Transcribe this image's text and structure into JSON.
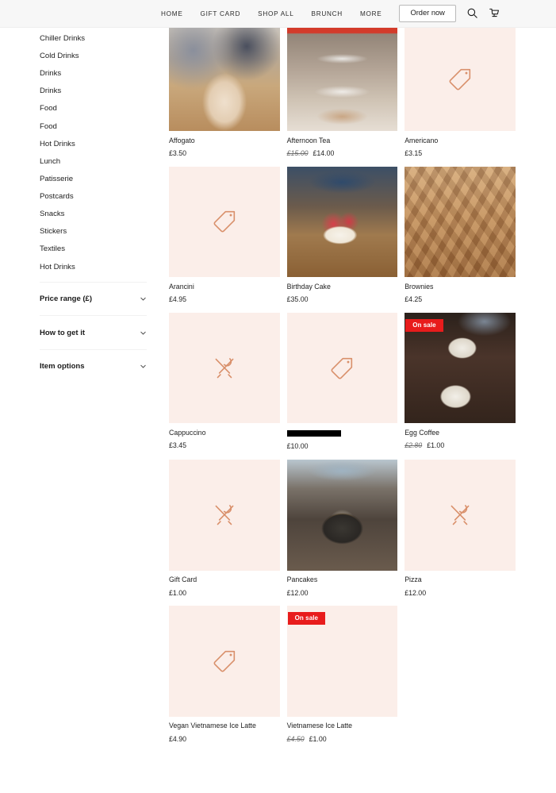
{
  "header": {
    "nav": [
      {
        "label": "HOME",
        "name": "nav-home"
      },
      {
        "label": "GIFT CARD",
        "name": "nav-gift-card"
      },
      {
        "label": "SHOP ALL",
        "name": "nav-shop-all"
      },
      {
        "label": "BRUNCH",
        "name": "nav-brunch"
      },
      {
        "label": "MORE",
        "name": "nav-more"
      }
    ],
    "order_now_label": "Order now",
    "search_icon": "search-icon",
    "cart_icon": "shopping-cart-icon",
    "background": "#f7f7f7"
  },
  "sidebar": {
    "categories": [
      {
        "label": "Chiller Drinks"
      },
      {
        "label": "Cold Drinks"
      },
      {
        "label": "Drinks"
      },
      {
        "label": "Drinks"
      },
      {
        "label": "Food"
      },
      {
        "label": "Food"
      },
      {
        "label": "Hot Drinks"
      },
      {
        "label": "Lunch"
      },
      {
        "label": "Patisserie"
      },
      {
        "label": "Postcards"
      },
      {
        "label": "Snacks"
      },
      {
        "label": "Stickers"
      },
      {
        "label": "Textiles"
      },
      {
        "label": "Hot Drinks"
      }
    ],
    "filters": [
      {
        "label": "Price range (£)",
        "icon": "chevron-down-icon",
        "expanded": false
      },
      {
        "label": "How to get it",
        "icon": "chevron-down-icon",
        "expanded": false
      },
      {
        "label": "Item options",
        "icon": "chevron-down-icon",
        "expanded": false
      }
    ]
  },
  "badges": {
    "on_sale": "On sale",
    "on_sale_color": "#e81c1c"
  },
  "products": [
    {
      "title": "Affogato",
      "price": "£3.50",
      "old_price": null,
      "on_sale": false,
      "media": "photo",
      "photo_class": "ph-affogato",
      "placeholder_icon": null
    },
    {
      "title": "Afternoon Tea",
      "price": "£14.00",
      "old_price": "£15.00",
      "on_sale": false,
      "media": "photo",
      "photo_class": "ph-afternoon",
      "placeholder_icon": null
    },
    {
      "title": "Americano",
      "price": "£3.15",
      "old_price": null,
      "on_sale": false,
      "media": "placeholder",
      "photo_class": null,
      "placeholder_icon": "tag-icon"
    },
    {
      "title": "Arancini",
      "price": "£4.95",
      "old_price": null,
      "on_sale": false,
      "media": "placeholder",
      "photo_class": null,
      "placeholder_icon": "tag-icon"
    },
    {
      "title": "Birthday Cake",
      "price": "£35.00",
      "old_price": null,
      "on_sale": false,
      "media": "photo",
      "photo_class": "ph-birthday",
      "placeholder_icon": null
    },
    {
      "title": "Brownies",
      "price": "£4.25",
      "old_price": null,
      "on_sale": false,
      "media": "photo",
      "photo_class": "ph-brownies",
      "placeholder_icon": null
    },
    {
      "title": "Cappuccino",
      "price": "£3.45",
      "old_price": null,
      "on_sale": false,
      "media": "placeholder",
      "photo_class": null,
      "placeholder_icon": "cutlery-icon"
    },
    {
      "title": "",
      "title_redacted": true,
      "price": "£10.00",
      "old_price": null,
      "on_sale": false,
      "media": "placeholder",
      "photo_class": null,
      "placeholder_icon": "tag-icon"
    },
    {
      "title": "Egg Coffee",
      "price": "£1.00",
      "old_price": "£2.80",
      "on_sale": true,
      "media": "photo",
      "photo_class": "ph-eggcoffee",
      "placeholder_icon": null
    },
    {
      "title": "Gift Card",
      "price": "£1.00",
      "old_price": null,
      "on_sale": false,
      "media": "placeholder",
      "photo_class": null,
      "placeholder_icon": "cutlery-icon"
    },
    {
      "title": "Pancakes",
      "price": "£12.00",
      "old_price": null,
      "on_sale": false,
      "media": "photo",
      "photo_class": "ph-pancakes",
      "placeholder_icon": null
    },
    {
      "title": "Pizza",
      "price": "£12.00",
      "old_price": null,
      "on_sale": false,
      "media": "placeholder",
      "photo_class": null,
      "placeholder_icon": "cutlery-icon"
    },
    {
      "title": "Vegan Vietnamese Ice Latte",
      "price": "£4.90",
      "old_price": null,
      "on_sale": false,
      "media": "placeholder",
      "photo_class": null,
      "placeholder_icon": "tag-icon"
    },
    {
      "title": "Vietnamese Ice Latte",
      "price": "£1.00",
      "old_price": "£4.50",
      "on_sale": true,
      "media": "photo",
      "photo_class": "ph-vietnamese",
      "placeholder_icon": null
    }
  ]
}
